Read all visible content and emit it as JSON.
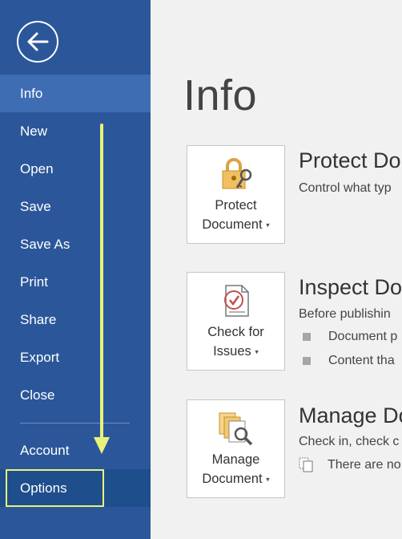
{
  "sidebar": {
    "items": [
      {
        "label": "Info"
      },
      {
        "label": "New"
      },
      {
        "label": "Open"
      },
      {
        "label": "Save"
      },
      {
        "label": "Save As"
      },
      {
        "label": "Print"
      },
      {
        "label": "Share"
      },
      {
        "label": "Export"
      },
      {
        "label": "Close"
      },
      {
        "label": "Account"
      },
      {
        "label": "Options"
      }
    ],
    "active_item": "Info"
  },
  "main": {
    "title": "Info",
    "sections": [
      {
        "tile_line1": "Protect",
        "tile_line2": "Document",
        "heading": "Protect Do",
        "description": "Control what typ"
      },
      {
        "tile_line1": "Check for",
        "tile_line2": "Issues",
        "heading": "Inspect Do",
        "description": "Before publishin",
        "bullets": [
          "Document p",
          "Content tha"
        ]
      },
      {
        "tile_line1": "Manage",
        "tile_line2": "Document",
        "heading": "Manage Do",
        "description": "Check in, check c",
        "note": "There are no"
      }
    ]
  },
  "icons": {
    "back": "back-arrow-icon",
    "protect": "lock-key-icon",
    "inspect": "document-check-icon",
    "manage": "documents-search-icon"
  },
  "colors": {
    "sidebar": "#2b579a",
    "active_item": "#3e6db4",
    "highlight": "#e9f27a"
  }
}
